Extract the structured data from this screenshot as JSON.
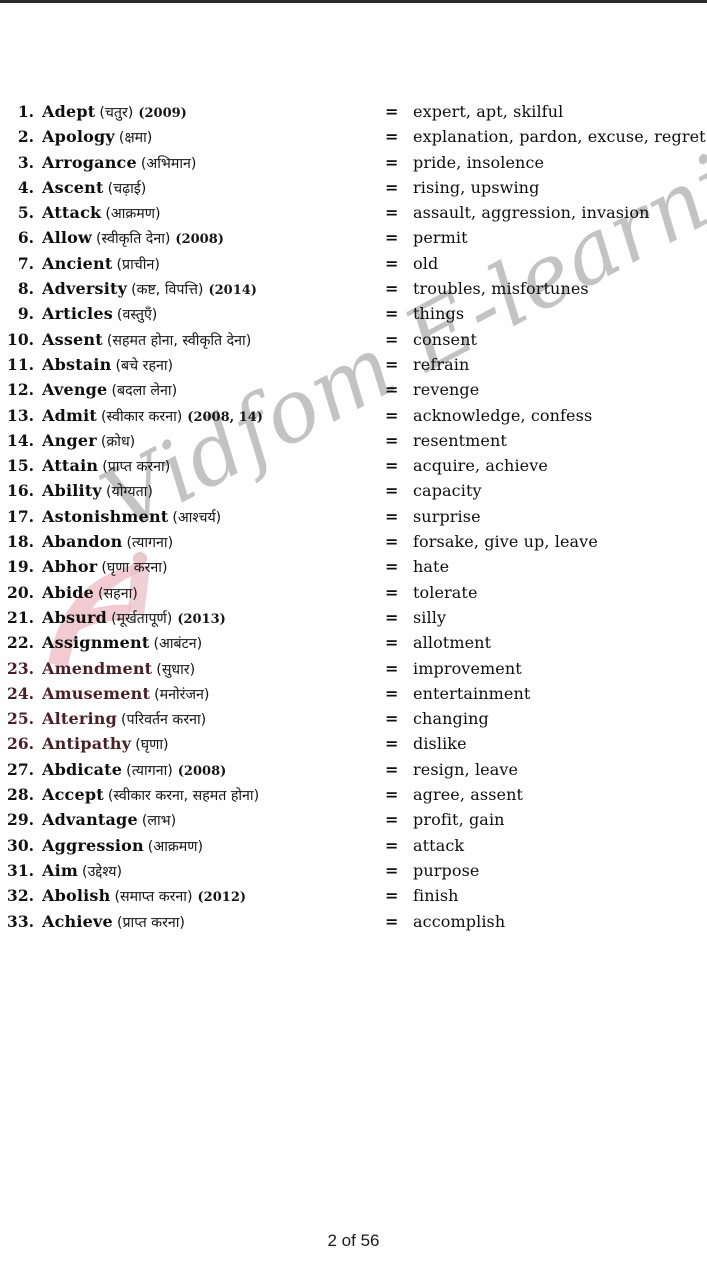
{
  "page": {
    "footer_label": "2 of 56",
    "watermark_text": "Vidfom E-learning",
    "watermark_logo_name": "f-logo-watermark",
    "equals_sign": "=",
    "accent_color": "#e39aa6",
    "watermark_color": "#b9b9b9",
    "text_color": "#0e0e0e"
  },
  "entries": [
    {
      "num": "1.",
      "word": "Adept",
      "hindi": "(चतुर)",
      "year": "(2009)",
      "meaning": "expert, apt, skilful"
    },
    {
      "num": "2.",
      "word": "Apology",
      "hindi": "(क्षमा)",
      "year": "",
      "meaning": "explanation, pardon, excuse, regret"
    },
    {
      "num": "3.",
      "word": "Arrogance",
      "hindi": "(अभिमान)",
      "year": "",
      "meaning": "pride, insolence"
    },
    {
      "num": "4.",
      "word": "Ascent",
      "hindi": "(चढ़ाई)",
      "year": "",
      "meaning": "rising, upswing"
    },
    {
      "num": "5.",
      "word": "Attack",
      "hindi": "(आक्रमण)",
      "year": "",
      "meaning": "assault, aggression, invasion"
    },
    {
      "num": "6.",
      "word": "Allow",
      "hindi": "(स्वीकृति देना)",
      "year": "(2008)",
      "meaning": "permit"
    },
    {
      "num": "7.",
      "word": "Ancient",
      "hindi": "(प्राचीन)",
      "year": "",
      "meaning": "old"
    },
    {
      "num": "8.",
      "word": "Adversity",
      "hindi": "(कष्ट, विपत्ति)",
      "year": "(2014)",
      "meaning": "troubles, misfortunes"
    },
    {
      "num": "9.",
      "word": "Articles",
      "hindi": "(वस्तुएँ)",
      "year": "",
      "meaning": "things"
    },
    {
      "num": "10.",
      "word": "Assent",
      "hindi": "(सहमत होना, स्वीकृति देना)",
      "year": "",
      "meaning": "consent"
    },
    {
      "num": "11.",
      "word": "Abstain",
      "hindi": "(बचे रहना)",
      "year": "",
      "meaning": "refrain"
    },
    {
      "num": "12.",
      "word": "Avenge",
      "hindi": "(बदला लेना)",
      "year": "",
      "meaning": "revenge"
    },
    {
      "num": "13.",
      "word": "Admit",
      "hindi": "(स्वीकार करना)",
      "year": "(2008, 14)",
      "meaning": "acknowledge, confess"
    },
    {
      "num": "14.",
      "word": "Anger",
      "hindi": "(क्रोध)",
      "year": "",
      "meaning": "resentment"
    },
    {
      "num": "15.",
      "word": "Attain",
      "hindi": "(प्राप्त करना)",
      "year": "",
      "meaning": "acquire, achieve"
    },
    {
      "num": "16.",
      "word": "Ability",
      "hindi": "(योग्यता)",
      "year": "",
      "meaning": "capacity"
    },
    {
      "num": "17.",
      "word": "Astonishment",
      "hindi": "(आश्चर्य)",
      "year": "",
      "meaning": "surprise"
    },
    {
      "num": "18.",
      "word": "Abandon",
      "hindi": "(त्यागना)",
      "year": "",
      "meaning": "forsake, give up, leave"
    },
    {
      "num": "19.",
      "word": "Abhor",
      "hindi": "(घृणा करना)",
      "year": "",
      "meaning": "hate"
    },
    {
      "num": "20.",
      "word": "Abide",
      "hindi": "(सहना)",
      "year": "",
      "meaning": "tolerate"
    },
    {
      "num": "21.",
      "word": "Absurd",
      "hindi": "(मूर्खतापूर्ण)",
      "year": "(2013)",
      "meaning": "silly"
    },
    {
      "num": "22.",
      "word": "Assignment",
      "hindi": "(आबंटन)",
      "year": "",
      "meaning": "allotment"
    },
    {
      "num": "23.",
      "word": "Amendment",
      "hindi": "(सुधार)",
      "year": "",
      "meaning": "improvement"
    },
    {
      "num": "24.",
      "word": "Amusement",
      "hindi": "(मनोरंजन)",
      "year": "",
      "meaning": "entertainment"
    },
    {
      "num": "25.",
      "word": "Altering",
      "hindi": "(परिवर्तन करना)",
      "year": "",
      "meaning": "changing"
    },
    {
      "num": "26.",
      "word": "Antipathy",
      "hindi": "(घृणा)",
      "year": "",
      "meaning": "dislike"
    },
    {
      "num": "27.",
      "word": "Abdicate",
      "hindi": "(त्यागना)",
      "year": "(2008)",
      "meaning": "resign, leave"
    },
    {
      "num": "28.",
      "word": "Accept",
      "hindi": "(स्वीकार करना, सहमत होना)",
      "year": "",
      "meaning": "agree, assent"
    },
    {
      "num": "29.",
      "word": "Advantage",
      "hindi": "(लाभ)",
      "year": "",
      "meaning": "profit, gain"
    },
    {
      "num": "30.",
      "word": "Aggression",
      "hindi": "(आक्रमण)",
      "year": "",
      "meaning": "attack"
    },
    {
      "num": "31.",
      "word": "Aim",
      "hindi": "(उद्देश्य)",
      "year": "",
      "meaning": "purpose"
    },
    {
      "num": "32.",
      "word": "Abolish",
      "hindi": "(समाप्त करना)",
      "year": "(2012)",
      "meaning": "finish"
    },
    {
      "num": "33.",
      "word": "Achieve",
      "hindi": "(प्राप्त करना)",
      "year": "",
      "meaning": "accomplish"
    }
  ]
}
